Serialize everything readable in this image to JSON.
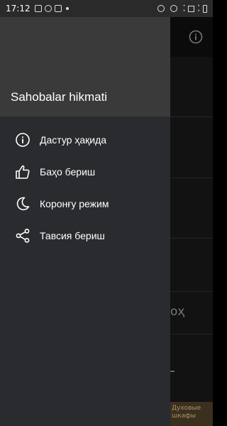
{
  "status_bar": {
    "time": "17:12"
  },
  "drawer": {
    "title": "Sahobalar hikmati",
    "items": [
      {
        "label": "Дастур ҳақида",
        "icon": "info-icon"
      },
      {
        "label": "Баҳо бериш",
        "icon": "thumb-up-icon"
      },
      {
        "label": "Коронғу режим",
        "icon": "moon-icon"
      },
      {
        "label": "Тавсия бериш",
        "icon": "share-icon"
      }
    ]
  },
  "background": {
    "fragment_text": "оҳ",
    "ad_text": "Духовые шкафы"
  },
  "colors": {
    "drawer_bg": "#2a2b2f",
    "drawer_header_bg": "#3a3a3a",
    "text": "#ffffff"
  }
}
